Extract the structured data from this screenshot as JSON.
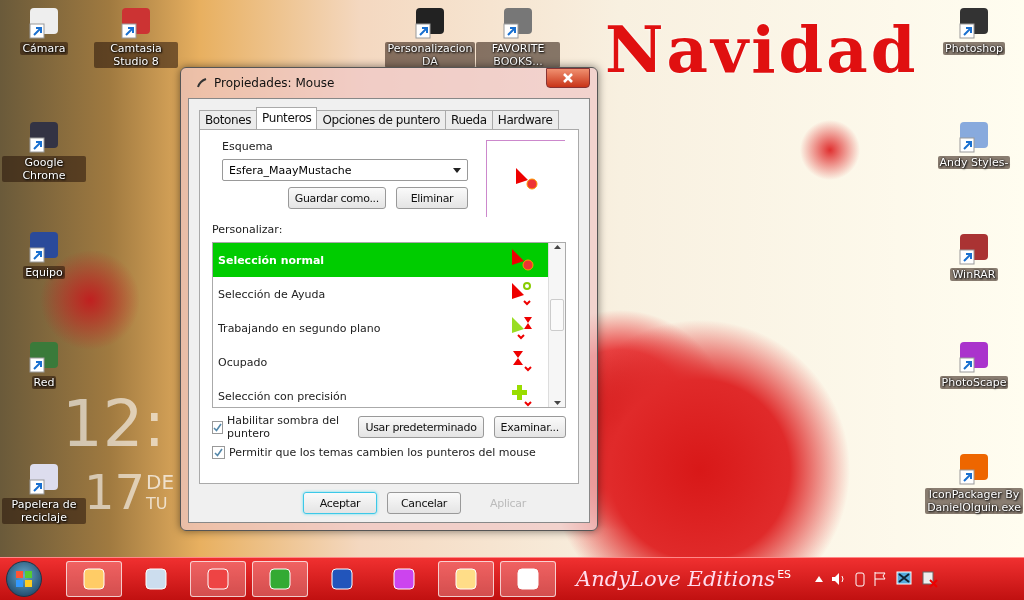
{
  "desktop_title": "Navidad",
  "clock_widget": {
    "time": "12:",
    "day": "17",
    "month": "DE",
    "weekday": "TU"
  },
  "desktop_icons": [
    {
      "label": "Cámara",
      "kind": "camera"
    },
    {
      "label": "Camtasia Studio 8",
      "kind": "camtasia"
    },
    {
      "label": "Personalizacion DA",
      "kind": "book"
    },
    {
      "label": "FAVORITE BOOKS...",
      "kind": "books"
    },
    {
      "label": "Google Chrome",
      "kind": "disc"
    },
    {
      "label": "Equipo",
      "kind": "computer"
    },
    {
      "label": "Red",
      "kind": "network"
    },
    {
      "label": "Papelera de reciclaje",
      "kind": "trash"
    },
    {
      "label": "Photoshop",
      "kind": "photo"
    },
    {
      "label": "Andy Styles-",
      "kind": "styles"
    },
    {
      "label": "WinRAR",
      "kind": "archive"
    },
    {
      "label": "PhotoScape",
      "kind": "purple"
    },
    {
      "label": "IconPackager By DanielOlguin.exe",
      "kind": "package"
    }
  ],
  "dialog": {
    "title": "Propiedades: Mouse",
    "tabs": [
      {
        "label": "Botones",
        "selected": false
      },
      {
        "label": "Punteros",
        "selected": true
      },
      {
        "label": "Opciones de puntero",
        "selected": false
      },
      {
        "label": "Rueda",
        "selected": false
      },
      {
        "label": "Hardware",
        "selected": false
      }
    ],
    "scheme_label": "Esquema",
    "scheme_value": "Esfera_MaayMustache",
    "save_as_button": "Guardar como...",
    "delete_button": "Eliminar",
    "customize_label": "Personalizar:",
    "pointers": [
      {
        "label": "Selección normal",
        "kind": "normal",
        "selected": true
      },
      {
        "label": "Selección de Ayuda",
        "kind": "help",
        "selected": false
      },
      {
        "label": "Trabajando en segundo plano",
        "kind": "working",
        "selected": false
      },
      {
        "label": "Ocupado",
        "kind": "busy",
        "selected": false
      },
      {
        "label": "Selección con precisión",
        "kind": "precision",
        "selected": false
      }
    ],
    "shadow_checkbox": {
      "label": "Habilitar sombra del puntero",
      "checked": true
    },
    "default_button": "Usar predeterminado",
    "browse_button": "Examinar...",
    "themes_checkbox": {
      "label": "Permitir que los temas cambien los punteros del mouse",
      "checked": true
    },
    "buttons": [
      {
        "label": "Aceptar",
        "kind": "default",
        "disabled": false
      },
      {
        "label": "Cancelar",
        "kind": "normal",
        "disabled": false
      },
      {
        "label": "Aplicar",
        "kind": "normal",
        "disabled": true
      }
    ]
  },
  "taskbar": {
    "apps": [
      {
        "kind": "explorer",
        "active": true
      },
      {
        "kind": "notes",
        "active": false
      },
      {
        "kind": "camtasia",
        "active": true
      },
      {
        "kind": "chrome",
        "active": true
      },
      {
        "kind": "word",
        "active": false
      },
      {
        "kind": "cursor",
        "active": false
      },
      {
        "kind": "folder",
        "active": true
      },
      {
        "kind": "mouse",
        "active": true
      }
    ],
    "banner": "AndyLove Editions",
    "language": "ES"
  }
}
